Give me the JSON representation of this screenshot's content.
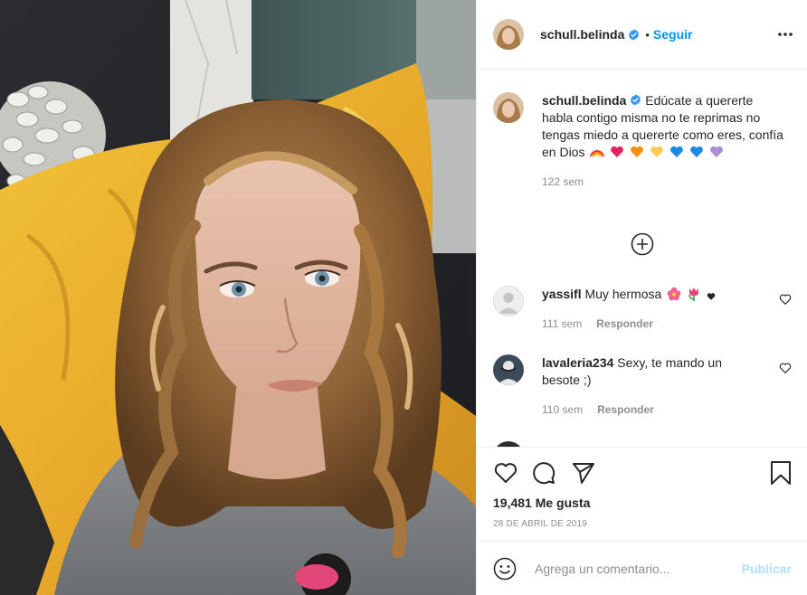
{
  "post": {
    "author": "schull.belinda",
    "verified": true,
    "follow_label": "Seguir",
    "separator": "•",
    "more_icon": "more-horizontal-icon",
    "image_alt": "Selfie de mujer con cabello rizado sobre un cojín amarillo"
  },
  "caption": {
    "username": "schull.belinda",
    "text": "Edúcate a quererte habla contigo misma no te reprimas no tengas miedo a quererte como eres, confía en Dios",
    "emojis": [
      "rainbow",
      "red-heart",
      "orange-heart",
      "yellow-heart",
      "blue-heart",
      "blue-heart",
      "purple-heart"
    ],
    "time": "122 sem"
  },
  "load_more_icon": "plus-circle-icon",
  "comments": [
    {
      "username": "yassifl",
      "text": "Muy hermosa",
      "emojis": [
        "hibiscus",
        "tulip",
        "black-heart"
      ],
      "time": "111 sem",
      "reply_label": "Responder"
    },
    {
      "username": "lavaleria234",
      "text": "Sexy, te mando un besote ;)",
      "emojis": [],
      "time": "110 sem",
      "reply_label": "Responder"
    }
  ],
  "actions": {
    "like_icon": "heart-icon",
    "comment_icon": "comment-icon",
    "share_icon": "paper-plane-icon",
    "save_icon": "bookmark-icon"
  },
  "likes_text": "19,481 Me gusta",
  "date_text": "28 DE ABRIL DE 2019",
  "add_comment": {
    "placeholder": "Agrega un comentario...",
    "publish_label": "Publicar",
    "emoji_icon": "smiley-icon"
  },
  "colors": {
    "link_blue": "#0095f6",
    "publish_disabled": "#b2dffc",
    "muted_text": "#8e8e8e",
    "divider": "#efefef",
    "verified_badge": "#3897f0"
  }
}
